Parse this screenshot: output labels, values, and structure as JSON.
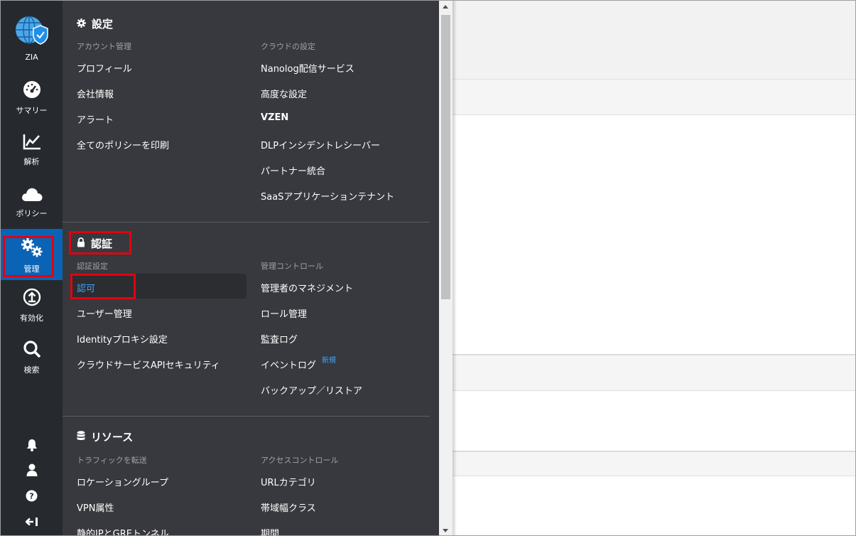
{
  "rail": {
    "items": [
      {
        "label": "ZIA",
        "icon": "globe-shield-icon"
      },
      {
        "label": "サマリー",
        "icon": "dashboard-gauge-icon"
      },
      {
        "label": "解析",
        "icon": "line-chart-icon"
      },
      {
        "label": "ポリシー",
        "icon": "cloud-icon"
      },
      {
        "label": "管理",
        "icon": "gears-icon",
        "active": true
      },
      {
        "label": "有効化",
        "icon": "upload-circle-icon"
      },
      {
        "label": "検索",
        "icon": "search-icon"
      }
    ],
    "bottom_icons": [
      "bell-icon",
      "user-icon",
      "help-icon",
      "logout-icon"
    ],
    "active_color": "#0b63b5"
  },
  "menu": {
    "settings": {
      "title": "設定",
      "left": {
        "subtitle": "アカウント管理",
        "items": [
          "プロフィール",
          "会社情報",
          "アラート",
          "全てのポリシーを印刷"
        ]
      },
      "right": {
        "subtitle": "クラウドの設定",
        "items": [
          "Nanolog配信サービス",
          "高度な設定",
          "VZEN",
          "DLPインシデントレシーバー",
          "パートナー統合",
          "SaaSアプリケーションテナント"
        ]
      }
    },
    "auth": {
      "title": "認証",
      "left": {
        "subtitle": "認証設定",
        "items": [
          "認可",
          "ユーザー管理",
          "Identityプロキシ設定",
          "クラウドサービスAPIセキュリティ"
        ]
      },
      "right": {
        "subtitle": "管理コントロール",
        "items": [
          "管理者のマネジメント",
          "ロール管理",
          "監査ログ",
          "イベントログ",
          "バックアップ／リストア"
        ],
        "badge": "新規"
      }
    },
    "resources": {
      "title": "リソース",
      "left": {
        "subtitle": "トラフィックを転送",
        "items": [
          "ロケーショングループ",
          "VPN属性",
          "静的IPとGREトンネル"
        ]
      },
      "right": {
        "subtitle": "アクセスコントロール",
        "items": [
          "URLカテゴリ",
          "帯域幅クラス",
          "期間"
        ]
      }
    },
    "colors": {
      "background": "#37393e",
      "subtitle": "#9ea2a8",
      "link_active": "#3ea5ff",
      "highlight": "#e3000f"
    }
  }
}
